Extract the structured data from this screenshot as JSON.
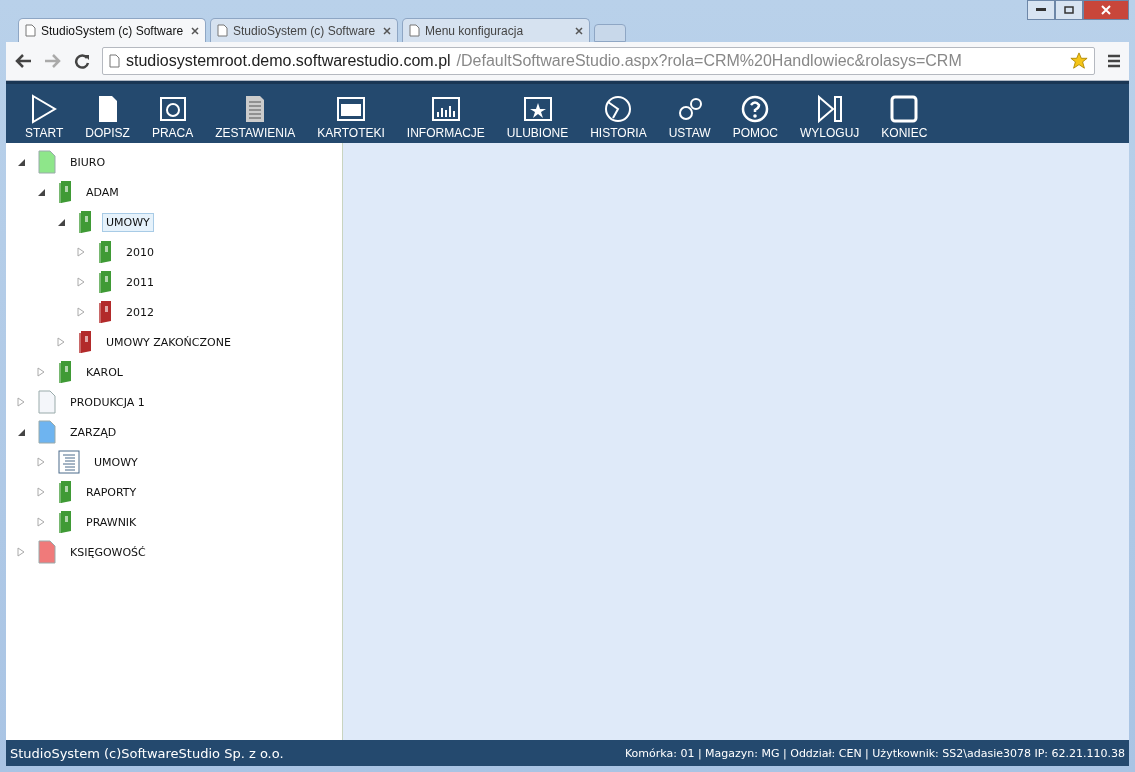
{
  "browser": {
    "tabs": [
      {
        "title": "StudioSystem (c) Software",
        "selected": true
      },
      {
        "title": "StudioSystem (c) Software",
        "selected": false
      },
      {
        "title": "Menu konfiguracja",
        "selected": false
      }
    ],
    "address": {
      "host": "studiosystemroot.demo.softwarestudio.com.pl",
      "path": "/DefaultSoftwareStudio.aspx?rola=CRM%20Handlowiec&rolasys=CRM"
    }
  },
  "toolbar": [
    "START",
    "DOPISZ",
    "PRACA",
    "ZESTAWIENIA",
    "KARTOTEKI",
    "INFORMACJE",
    "ULUBIONE",
    "HISTORIA",
    "USTAW",
    "POMOC",
    "WYLOGUJ",
    "KONIEC"
  ],
  "tree": [
    {
      "label": "BIURO",
      "kind": "page",
      "color": "#8ee68a",
      "expanded": true,
      "selected": false,
      "children": [
        {
          "label": "ADAM",
          "kind": "binder",
          "color": "#3f9a35",
          "expanded": true,
          "selected": false,
          "children": [
            {
              "label": "UMOWY",
              "kind": "binder",
              "color": "#3f9a35",
              "expanded": true,
              "selected": true,
              "children": [
                {
                  "label": "2010",
                  "kind": "binder",
                  "color": "#3f9a35",
                  "expanded": false,
                  "selected": false
                },
                {
                  "label": "2011",
                  "kind": "binder",
                  "color": "#3f9a35",
                  "expanded": false,
                  "selected": false
                },
                {
                  "label": "2012",
                  "kind": "binder",
                  "color": "#b22a2a",
                  "expanded": false,
                  "selected": false
                }
              ]
            },
            {
              "label": "UMOWY ZAKOŃCZONE",
              "kind": "binder",
              "color": "#b22a2a",
              "expanded": false,
              "selected": false
            }
          ]
        },
        {
          "label": "KAROL",
          "kind": "binder",
          "color": "#3f9a35",
          "expanded": false,
          "selected": false
        }
      ]
    },
    {
      "label": "PRODUKCJA 1",
      "kind": "page",
      "color": "#f4f6fa",
      "expanded": false,
      "selected": false
    },
    {
      "label": "ZARZĄD",
      "kind": "page",
      "color": "#6eb4f0",
      "expanded": true,
      "selected": false,
      "children": [
        {
          "label": "UMOWY",
          "kind": "list",
          "expanded": false,
          "selected": false
        },
        {
          "label": "RAPORTY",
          "kind": "binder",
          "color": "#3f9a35",
          "expanded": false,
          "selected": false
        },
        {
          "label": "PRAWNIK",
          "kind": "binder",
          "color": "#3f9a35",
          "expanded": false,
          "selected": false
        }
      ]
    },
    {
      "label": "KSIĘGOWOŚĆ",
      "kind": "page",
      "color": "#f07a7a",
      "expanded": false,
      "selected": false
    }
  ],
  "status_bar": {
    "left": "StudioSystem (c)SoftwareStudio Sp. z o.o.",
    "right": "Komórka: 01 | Magazyn: MG | Oddział: CEN | Użytkownik: SS2\\adasie3078 IP: 62.21.110.38"
  }
}
